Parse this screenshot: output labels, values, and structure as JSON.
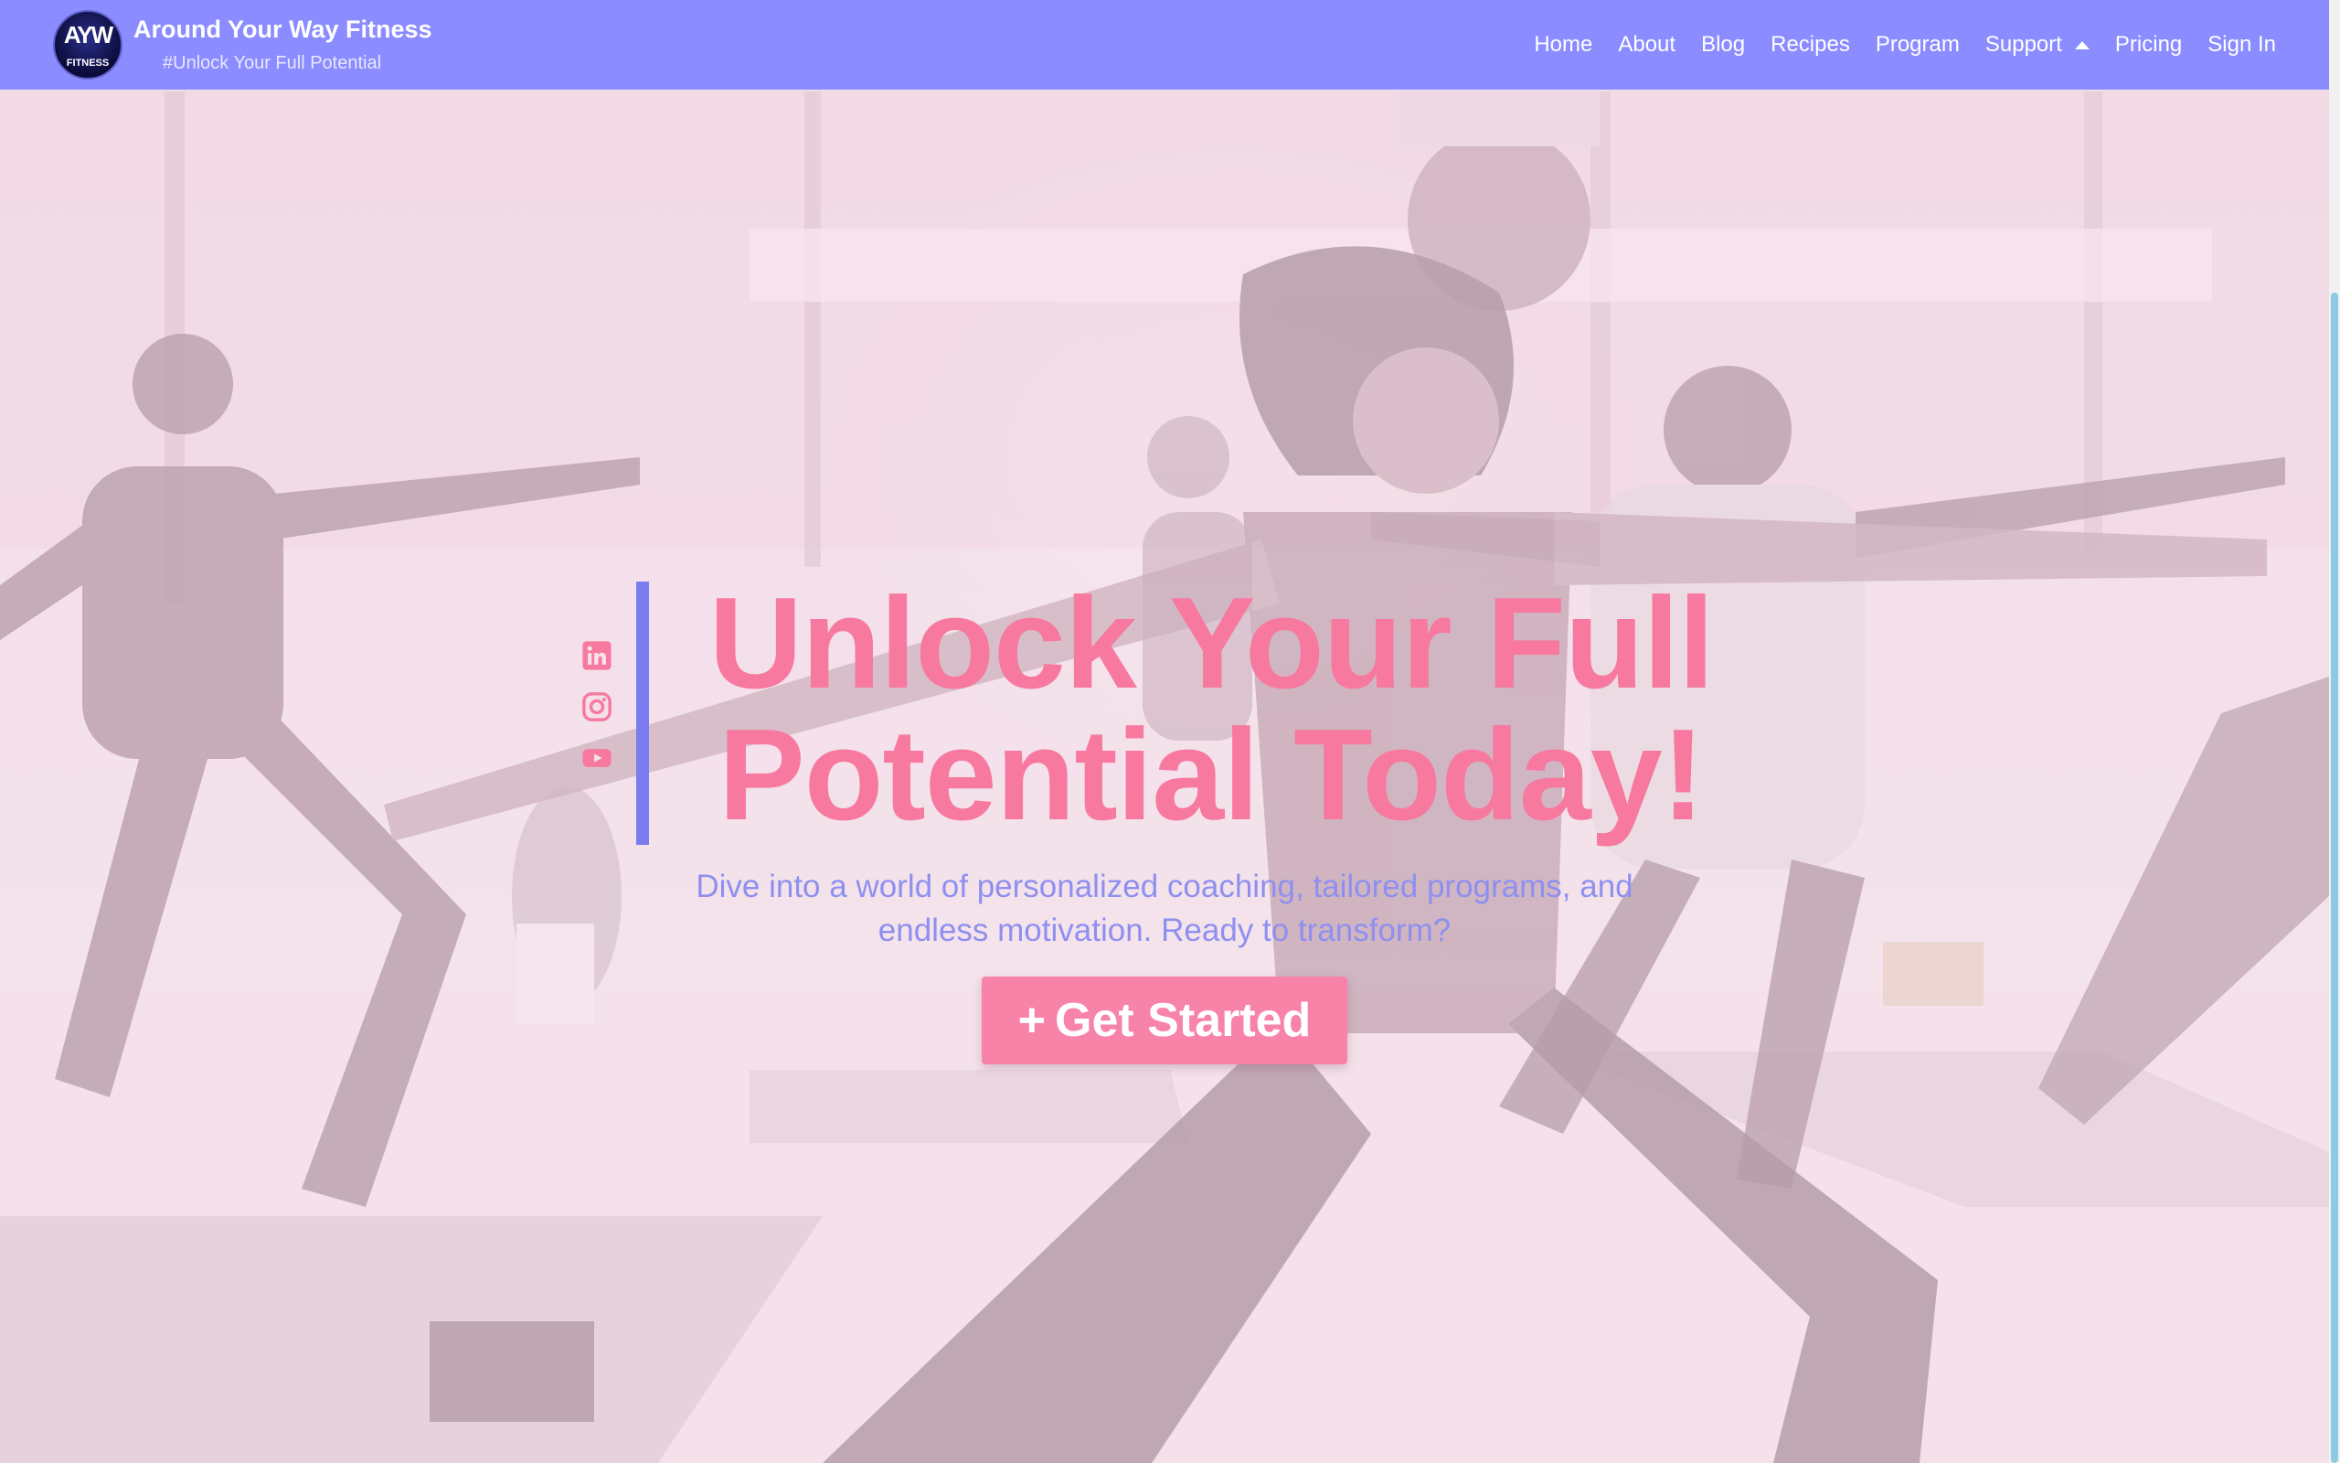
{
  "brand": {
    "logo_top": "AYW",
    "logo_bottom": "FITNESS",
    "name": "Around Your Way Fitness",
    "tagline": "#Unlock Your Full Potential"
  },
  "nav": {
    "items": [
      {
        "label": "Home"
      },
      {
        "label": "About"
      },
      {
        "label": "Blog"
      },
      {
        "label": "Recipes"
      },
      {
        "label": "Program"
      },
      {
        "label": "Support",
        "icon": "caret-up-icon"
      },
      {
        "label": "Pricing"
      },
      {
        "label": "Sign In"
      }
    ]
  },
  "hero": {
    "headline_line1": "Unlock Your Full",
    "headline_line2": "Potential Today!",
    "subtext": "Dive into a world of personalized coaching, tailored programs, and endless motivation. Ready to transform?",
    "cta_icon": "+",
    "cta_label": "Get Started",
    "social_icons": [
      "linkedin-icon",
      "instagram-icon",
      "youtube-icon"
    ]
  },
  "colors": {
    "navbar": "#8a8cff",
    "headline": "#f7799f",
    "subtext": "#8e8ff0",
    "cta": "#f883a8",
    "accent_bar": "#7a7cf0",
    "social": "#f7799f"
  }
}
